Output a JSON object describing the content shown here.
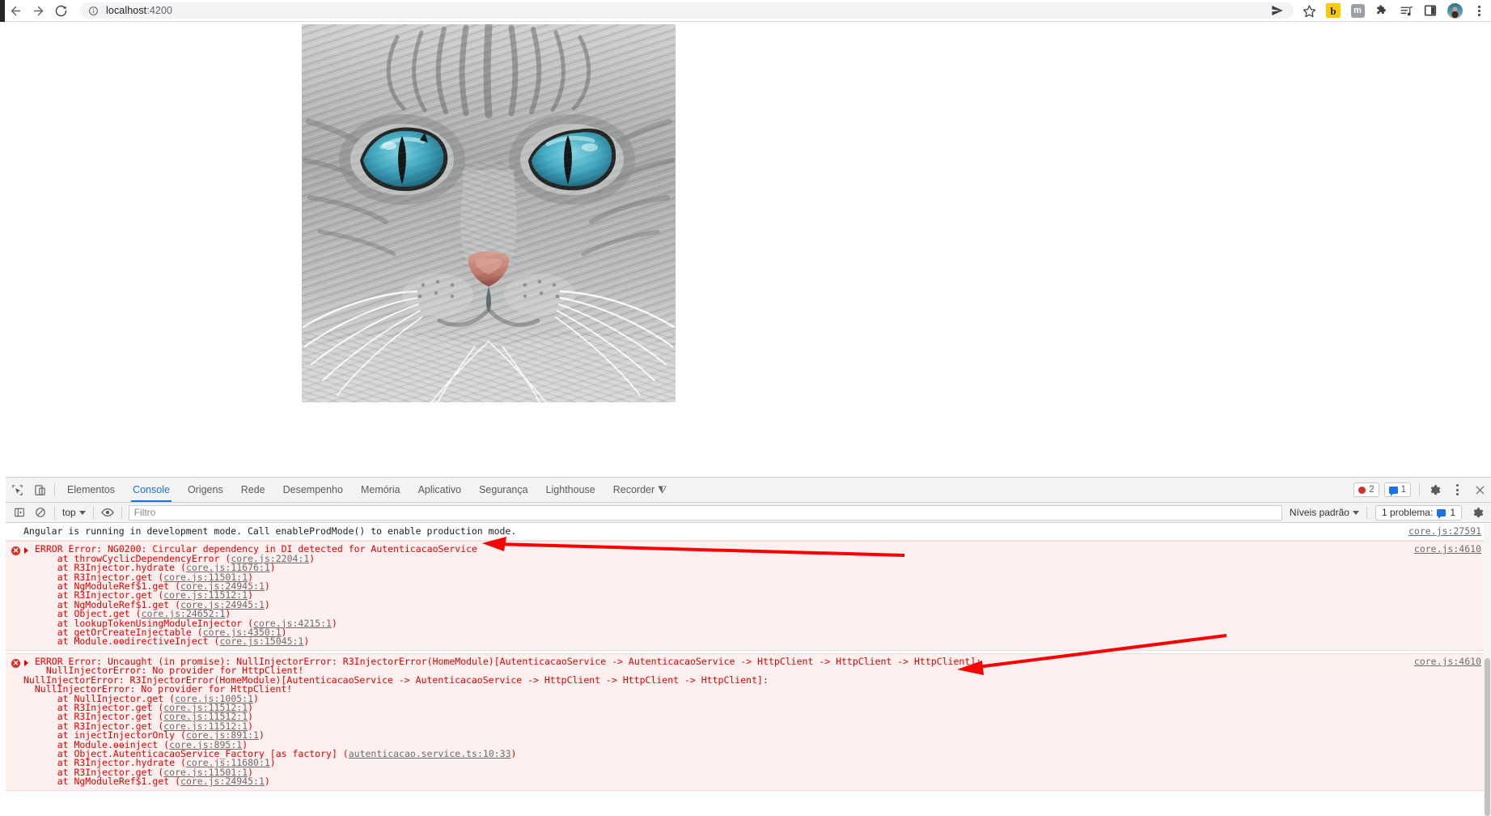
{
  "browser": {
    "back_label": "back-arrow",
    "forward_label": "forward-arrow",
    "reload_label": "reload",
    "url_host": "localhost",
    "url_port": ":4200",
    "info_icon": "info-circle-icon",
    "share_icon": "share-icon",
    "bookmark_icon": "star-icon",
    "extensions": [
      {
        "name": "bitwarden-extension-icon",
        "glyph": "b"
      },
      {
        "name": "metamask-extension-icon",
        "glyph": "m"
      },
      {
        "name": "puzzle-extensions-icon",
        "glyph": "puzzle"
      },
      {
        "name": "reading-list-icon",
        "glyph": "list-music"
      },
      {
        "name": "side-panel-icon",
        "glyph": "panel"
      }
    ],
    "profile_label": "user-avatar",
    "menu_label": "chrome-menu"
  },
  "page": {
    "image_alt": "cat-photo"
  },
  "devtools": {
    "inspect_icon": "inspect-element-icon",
    "device_icon": "toggle-device-toolbar-icon",
    "tabs": [
      {
        "label": "Elementos",
        "active": false
      },
      {
        "label": "Console",
        "active": true
      },
      {
        "label": "Origens",
        "active": false
      },
      {
        "label": "Rede",
        "active": false
      },
      {
        "label": "Desempenho",
        "active": false
      },
      {
        "label": "Memória",
        "active": false
      },
      {
        "label": "Aplicativo",
        "active": false
      },
      {
        "label": "Segurança",
        "active": false
      },
      {
        "label": "Lighthouse",
        "active": false
      },
      {
        "label": "Recorder",
        "active": false
      }
    ],
    "recorder_suffix": "⧨",
    "error_count": "2",
    "warning_count": "1",
    "settings_icon": "gear-icon",
    "more_icon": "kebab-menu-icon",
    "close_icon": "close-icon"
  },
  "console_toolbar": {
    "sidebar_icon": "console-sidebar-icon",
    "clear_icon": "clear-console-icon",
    "context_selector": "top",
    "eye_icon": "live-expression-icon",
    "filter_placeholder": "Filtro",
    "filter_value": "",
    "levels_selector": "Níveis padrão",
    "problems_label": "1 problema:",
    "problems_count": "1",
    "settings_icon": "console-settings-icon"
  },
  "console": {
    "info_message": {
      "text": "Angular is running in development mode. Call enableProdMode() to enable production mode.",
      "source": "core.js:27591"
    },
    "error1": {
      "headline": "ERROR Error: NG0200: Circular dependency in DI detected for AutenticacaoService",
      "source": "core.js:4610",
      "stack": [
        {
          "fn": "    at throwCyclicDependencyError (",
          "link": "core.js:2204:1",
          "close": ")"
        },
        {
          "fn": "    at R3Injector.hydrate (",
          "link": "core.js:11676:1",
          "close": ")"
        },
        {
          "fn": "    at R3Injector.get (",
          "link": "core.js:11501:1",
          "close": ")"
        },
        {
          "fn": "    at NgModuleRef$1.get (",
          "link": "core.js:24945:1",
          "close": ")"
        },
        {
          "fn": "    at R3Injector.get (",
          "link": "core.js:11512:1",
          "close": ")"
        },
        {
          "fn": "    at NgModuleRef$1.get (",
          "link": "core.js:24945:1",
          "close": ")"
        },
        {
          "fn": "    at Object.get (",
          "link": "core.js:24652:1",
          "close": ")"
        },
        {
          "fn": "    at lookupTokenUsingModuleInjector (",
          "link": "core.js:4215:1",
          "close": ")"
        },
        {
          "fn": "    at getOrCreateInjectable (",
          "link": "core.js:4350:1",
          "close": ")"
        },
        {
          "fn": "    at Module.ɵɵdirectiveInject (",
          "link": "core.js:15045:1",
          "close": ")"
        }
      ]
    },
    "error2": {
      "headline": "ERROR Error: Uncaught (in promise): NullInjectorError: R3InjectorError(HomeModule)[AutenticacaoService -> AutenticacaoService -> HttpClient -> HttpClient -> HttpClient]:",
      "line2": "  NullInjectorError: No provider for HttpClient!",
      "line3": "NullInjectorError: R3InjectorError(HomeModule)[AutenticacaoService -> AutenticacaoService -> HttpClient -> HttpClient -> HttpClient]:",
      "line4": "  NullInjectorError: No provider for HttpClient!",
      "source": "core.js:4610",
      "stack": [
        {
          "fn": "    at NullInjector.get (",
          "link": "core.js:1005:1",
          "close": ")"
        },
        {
          "fn": "    at R3Injector.get (",
          "link": "core.js:11512:1",
          "close": ")"
        },
        {
          "fn": "    at R3Injector.get (",
          "link": "core.js:11512:1",
          "close": ")"
        },
        {
          "fn": "    at R3Injector.get (",
          "link": "core.js:11512:1",
          "close": ")"
        },
        {
          "fn": "    at injectInjectorOnly (",
          "link": "core.js:891:1",
          "close": ")"
        },
        {
          "fn": "    at Module.ɵɵinject (",
          "link": "core.js:895:1",
          "close": ")"
        },
        {
          "fn": "    at Object.AutenticacaoService_Factory [as factory] (",
          "link": "autenticacao.service.ts:10:33",
          "close": ")"
        },
        {
          "fn": "    at R3Injector.hydrate (",
          "link": "core.js:11680:1",
          "close": ")"
        },
        {
          "fn": "    at R3Injector.get (",
          "link": "core.js:11501:1",
          "close": ")"
        },
        {
          "fn": "    at NgModuleRef$1.get (",
          "link": "core.js:24945:1",
          "close": ")"
        }
      ]
    }
  },
  "annotations": {
    "arrow_color": "#fa0000",
    "arrow1": "arrow-pointing-to-circular-dependency-error",
    "arrow2": "arrow-pointing-to-nullinjector-error"
  }
}
